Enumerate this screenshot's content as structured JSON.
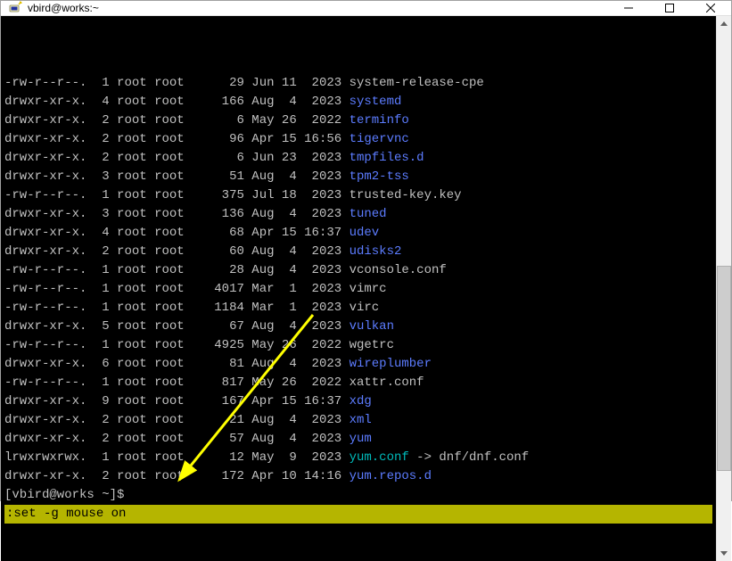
{
  "window": {
    "title": "vbird@works:~"
  },
  "listing": [
    {
      "perm": "-rw-r--r--.",
      "links": "1",
      "owner": "root",
      "group": "root",
      "size": "29",
      "month": "Jun",
      "day": "11",
      "time": "2023",
      "name": "system-release-cpe",
      "type": "file"
    },
    {
      "perm": "drwxr-xr-x.",
      "links": "4",
      "owner": "root",
      "group": "root",
      "size": "166",
      "month": "Aug",
      "day": "4",
      "time": "2023",
      "name": "systemd",
      "type": "dir"
    },
    {
      "perm": "drwxr-xr-x.",
      "links": "2",
      "owner": "root",
      "group": "root",
      "size": "6",
      "month": "May",
      "day": "26",
      "time": "2022",
      "name": "terminfo",
      "type": "dir"
    },
    {
      "perm": "drwxr-xr-x.",
      "links": "2",
      "owner": "root",
      "group": "root",
      "size": "96",
      "month": "Apr",
      "day": "15",
      "time": "16:56",
      "name": "tigervnc",
      "type": "dir"
    },
    {
      "perm": "drwxr-xr-x.",
      "links": "2",
      "owner": "root",
      "group": "root",
      "size": "6",
      "month": "Jun",
      "day": "23",
      "time": "2023",
      "name": "tmpfiles.d",
      "type": "dir"
    },
    {
      "perm": "drwxr-xr-x.",
      "links": "3",
      "owner": "root",
      "group": "root",
      "size": "51",
      "month": "Aug",
      "day": "4",
      "time": "2023",
      "name": "tpm2-tss",
      "type": "dir"
    },
    {
      "perm": "-rw-r--r--.",
      "links": "1",
      "owner": "root",
      "group": "root",
      "size": "375",
      "month": "Jul",
      "day": "18",
      "time": "2023",
      "name": "trusted-key.key",
      "type": "file"
    },
    {
      "perm": "drwxr-xr-x.",
      "links": "3",
      "owner": "root",
      "group": "root",
      "size": "136",
      "month": "Aug",
      "day": "4",
      "time": "2023",
      "name": "tuned",
      "type": "dir"
    },
    {
      "perm": "drwxr-xr-x.",
      "links": "4",
      "owner": "root",
      "group": "root",
      "size": "68",
      "month": "Apr",
      "day": "15",
      "time": "16:37",
      "name": "udev",
      "type": "dir"
    },
    {
      "perm": "drwxr-xr-x.",
      "links": "2",
      "owner": "root",
      "group": "root",
      "size": "60",
      "month": "Aug",
      "day": "4",
      "time": "2023",
      "name": "udisks2",
      "type": "dir"
    },
    {
      "perm": "-rw-r--r--.",
      "links": "1",
      "owner": "root",
      "group": "root",
      "size": "28",
      "month": "Aug",
      "day": "4",
      "time": "2023",
      "name": "vconsole.conf",
      "type": "file"
    },
    {
      "perm": "-rw-r--r--.",
      "links": "1",
      "owner": "root",
      "group": "root",
      "size": "4017",
      "month": "Mar",
      "day": "1",
      "time": "2023",
      "name": "vimrc",
      "type": "file"
    },
    {
      "perm": "-rw-r--r--.",
      "links": "1",
      "owner": "root",
      "group": "root",
      "size": "1184",
      "month": "Mar",
      "day": "1",
      "time": "2023",
      "name": "virc",
      "type": "file"
    },
    {
      "perm": "drwxr-xr-x.",
      "links": "5",
      "owner": "root",
      "group": "root",
      "size": "67",
      "month": "Aug",
      "day": "4",
      "time": "2023",
      "name": "vulkan",
      "type": "dir"
    },
    {
      "perm": "-rw-r--r--.",
      "links": "1",
      "owner": "root",
      "group": "root",
      "size": "4925",
      "month": "May",
      "day": "26",
      "time": "2022",
      "name": "wgetrc",
      "type": "file"
    },
    {
      "perm": "drwxr-xr-x.",
      "links": "6",
      "owner": "root",
      "group": "root",
      "size": "81",
      "month": "Aug",
      "day": "4",
      "time": "2023",
      "name": "wireplumber",
      "type": "dir"
    },
    {
      "perm": "-rw-r--r--.",
      "links": "1",
      "owner": "root",
      "group": "root",
      "size": "817",
      "month": "May",
      "day": "26",
      "time": "2022",
      "name": "xattr.conf",
      "type": "file"
    },
    {
      "perm": "drwxr-xr-x.",
      "links": "9",
      "owner": "root",
      "group": "root",
      "size": "167",
      "month": "Apr",
      "day": "15",
      "time": "16:37",
      "name": "xdg",
      "type": "dir"
    },
    {
      "perm": "drwxr-xr-x.",
      "links": "2",
      "owner": "root",
      "group": "root",
      "size": "21",
      "month": "Aug",
      "day": "4",
      "time": "2023",
      "name": "xml",
      "type": "dir"
    },
    {
      "perm": "drwxr-xr-x.",
      "links": "2",
      "owner": "root",
      "group": "root",
      "size": "57",
      "month": "Aug",
      "day": "4",
      "time": "2023",
      "name": "yum",
      "type": "dir"
    },
    {
      "perm": "lrwxrwxrwx.",
      "links": "1",
      "owner": "root",
      "group": "root",
      "size": "12",
      "month": "May",
      "day": "9",
      "time": "2023",
      "name": "yum.conf",
      "type": "link",
      "target": "dnf/dnf.conf"
    },
    {
      "perm": "drwxr-xr-x.",
      "links": "2",
      "owner": "root",
      "group": "root",
      "size": "172",
      "month": "Apr",
      "day": "10",
      "time": "14:16",
      "name": "yum.repos.d",
      "type": "dir"
    }
  ],
  "prompt": "[vbird@works ~]$ ",
  "status": ":set -g mouse on",
  "link_arrow": " -> "
}
